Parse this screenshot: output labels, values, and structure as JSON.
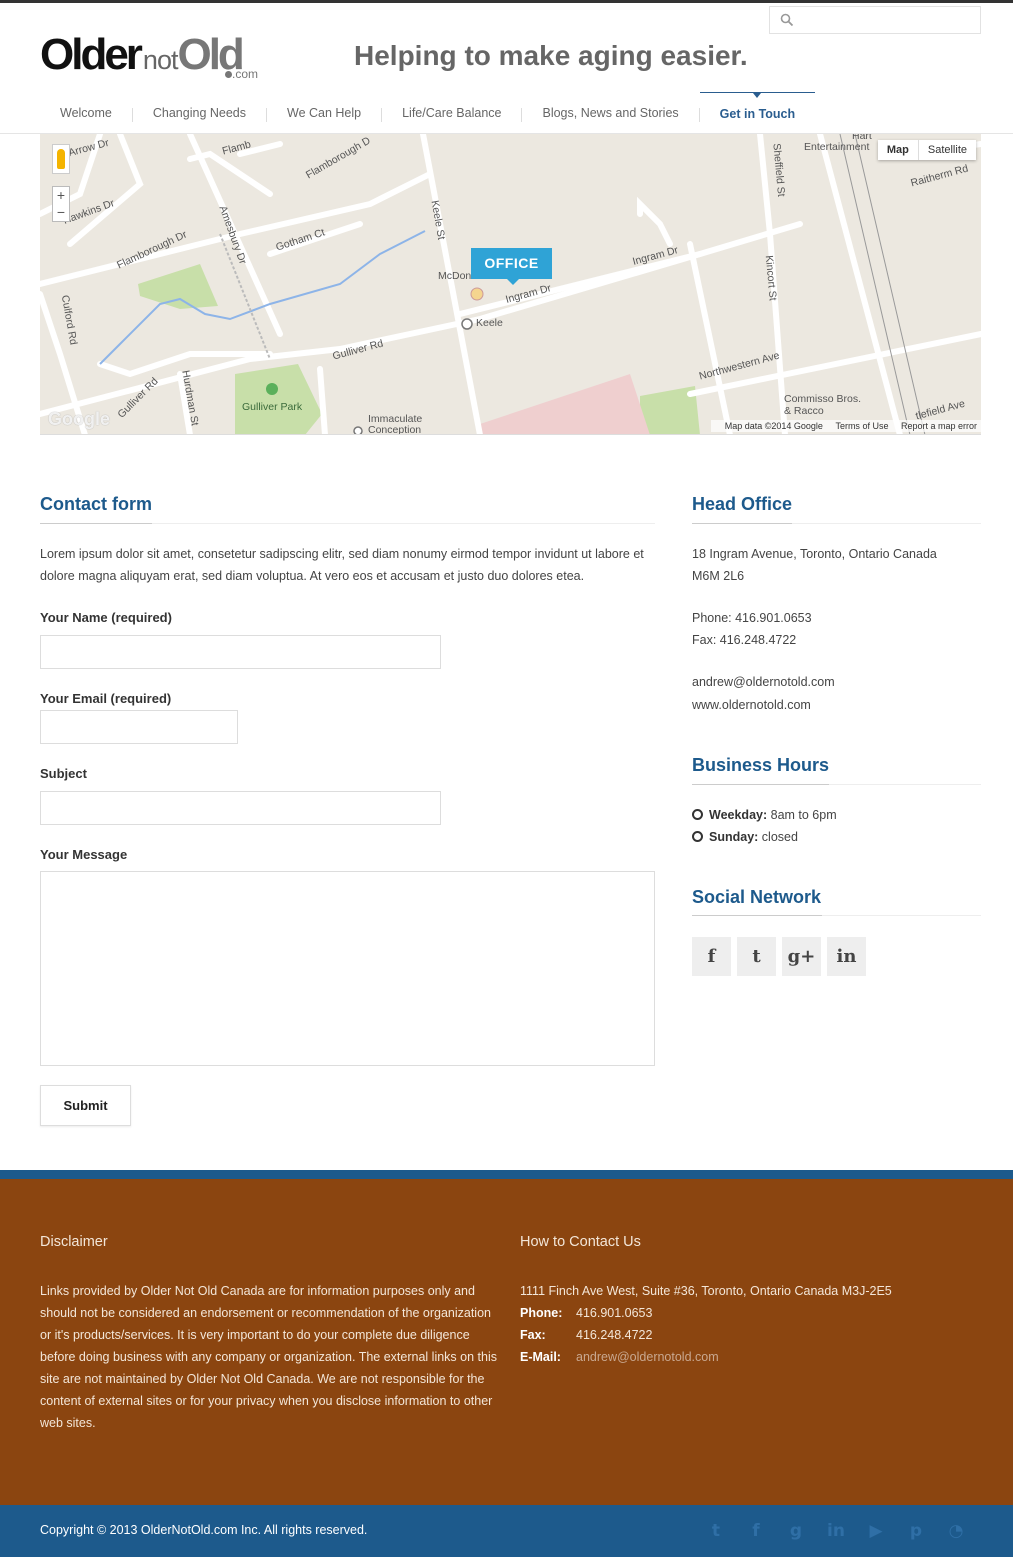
{
  "header": {
    "logo": {
      "older": "Older",
      "not": "not",
      "old": "Old",
      "com": ".com"
    },
    "tagline": "Helping to make aging easier.",
    "search": {
      "placeholder": "",
      "icon": "search-icon"
    }
  },
  "nav": {
    "items": [
      {
        "label": "Welcome"
      },
      {
        "label": "Changing Needs"
      },
      {
        "label": "We Can Help"
      },
      {
        "label": "Life/Care Balance"
      },
      {
        "label": "Blogs, News and Stories"
      },
      {
        "label": "Get in Touch",
        "active": true
      }
    ]
  },
  "map": {
    "marker": "OFFICE",
    "type_buttons": [
      "Map",
      "Satellite"
    ],
    "zoom_in": "+",
    "zoom_out": "−",
    "attribution": "Map data ©2014 Google",
    "terms": "Terms of Use",
    "report": "Report a map error",
    "google": "Google",
    "labels": {
      "arrow_dr": "Arrow Dr",
      "flamborough_dr": "Flamborough Dr",
      "flamborough_top": "Flamborough D",
      "hawkins": "Hawkins Dr",
      "gotham": "Gotham Ct",
      "amesbury": "Amesbury Dr",
      "keele_st": "Keele St",
      "mcdonalds": "McDonald's",
      "ingram_dr": "Ingram Dr",
      "ingram_dr2": "Ingram Dr",
      "keele_station": "Keele",
      "culford": "Culford Rd",
      "gulliver_rd": "Gulliver Rd",
      "gulliver_rd2": "Gulliver Rd",
      "hurdman": "Hurdman St",
      "gulliver_park": "Gulliver Park",
      "immaculate": "Immaculate Conception",
      "sheffield": "Sheffield St",
      "kincort": "Kincort St",
      "northwestern": "Northwestern Ave",
      "commisso": "Commisso Bros. & Racco",
      "raitherm": "Raitherm Rd",
      "entertainment": "Entertainment",
      "hart": "Hart",
      "flamborough_short": "Flamb",
      "castlefield": "tlefield Ave"
    }
  },
  "contact_form": {
    "title": "Contact form",
    "intro": "Lorem ipsum dolor sit amet, consetetur sadipscing elitr, sed diam nonumy eirmod tempor invidunt ut labore et dolore magna aliquyam erat, sed diam voluptua. At vero eos et accusam et justo duo dolores etea.",
    "name_label": "Your Name (required)",
    "name_value": "",
    "email_label": "Your Email (required)",
    "email_value": "",
    "subject_label": "Subject",
    "subject_value": "",
    "message_label": "Your Message",
    "message_value": "",
    "submit_label": "Submit"
  },
  "head_office": {
    "title": "Head Office",
    "address_line1": "18 Ingram Avenue, Toronto, Ontario Canada",
    "address_line2": "M6M 2L6",
    "phone": "Phone: 416.901.0653",
    "fax": "Fax: 416.248.4722",
    "email": "andrew@oldernotold.com",
    "website": "www.oldernotold.com"
  },
  "business_hours": {
    "title": "Business Hours",
    "weekday_label": "Weekday:",
    "weekday_value": " 8am to 6pm",
    "sunday_label": "Sunday:",
    "sunday_value": " closed"
  },
  "social": {
    "title": "Social Network",
    "buttons": [
      {
        "icon": "facebook-icon",
        "glyph": "f"
      },
      {
        "icon": "twitter-icon",
        "glyph": "t"
      },
      {
        "icon": "google-plus-icon",
        "glyph": "g+"
      },
      {
        "icon": "linkedin-icon",
        "glyph": "in"
      }
    ]
  },
  "footer": {
    "disclaimer_title": "Disclaimer",
    "disclaimer_text": "Links provided by Older Not Old Canada are for information purposes only and should not be considered an endorsement or recommendation of the organization or it's products/services. It is very important to do your complete due diligence before doing business with any company or organization. The external links on this site are not maintained by Older Not Old Canada. We are not responsible for the content of external sites or for your privacy when you disclose information to other web sites.",
    "contact_title": "How to Contact Us",
    "contact_address": "1111 Finch Ave West, Suite #36, Toronto, Ontario Canada M3J-2E5",
    "phone_label": "Phone:",
    "phone_value": "416.901.0653",
    "fax_label": "Fax:",
    "fax_value": "416.248.4722",
    "email_label": "E-Mail:",
    "email_value": "andrew@oldernotold.com",
    "copyright": "Copyright © 2013 OlderNotOld.com Inc. All rights reserved.",
    "social_icons": [
      "twitter-icon",
      "facebook-icon",
      "google-plus-icon",
      "linkedin-icon",
      "youtube-icon",
      "pinterest-icon",
      "rss-icon"
    ]
  },
  "colors": {
    "accent_blue": "#1d5a8c",
    "footer_brown": "#8b4510",
    "office_marker": "#2fa3d6"
  }
}
